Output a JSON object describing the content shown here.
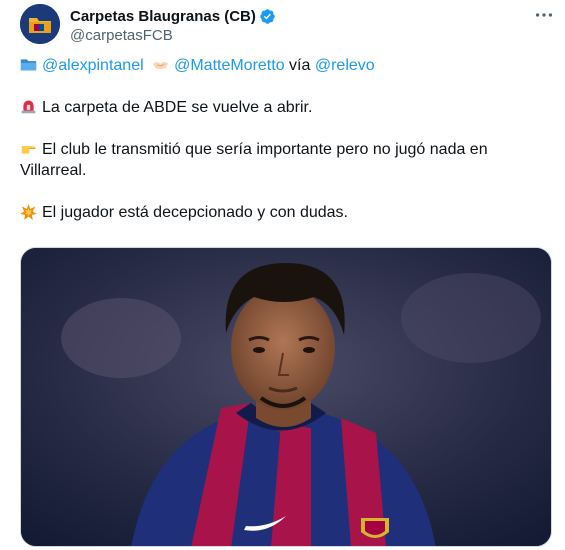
{
  "tweet": {
    "display_name": "Carpetas Blaugranas (CB)",
    "handle": "@carpetasFCB",
    "line1": {
      "mention1": "@alexpintanel",
      "mention2": "@MatteMoretto",
      "via_text": "vía",
      "mention3": "@relevo"
    },
    "line2": "La carpeta de ABDE se vuelve a abrir.",
    "line3a": "El club le transmitió que sería importante pero no jugó nada en",
    "line3b": "Villarreal.",
    "line4": "El jugador está decepcionado y con dudas."
  },
  "icons": {
    "avatar": "folder-logo-avatar",
    "verified": "verified-badge-icon",
    "more": "more-options-icon",
    "emoji_folder": "folder-emoji",
    "emoji_handshake": "handshake-emoji",
    "emoji_siren": "siren-emoji",
    "emoji_point": "pointing-right-emoji",
    "emoji_collision": "collision-emoji"
  },
  "colors": {
    "accent": "#1d9bf0",
    "text": "#0f1419",
    "secondary": "#536471",
    "border": "#cfd9de"
  }
}
